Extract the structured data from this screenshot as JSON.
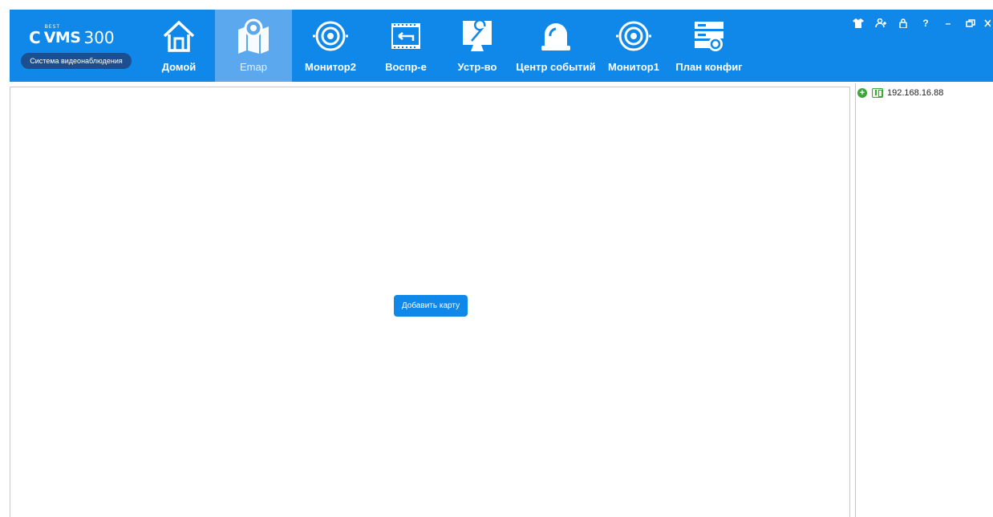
{
  "logo": {
    "brand_small": "BEST",
    "brand": "VMS",
    "number": "300",
    "subtitle": "Система видеонаблюдения"
  },
  "nav": {
    "items": [
      {
        "label": "Домой",
        "icon": "home-icon"
      },
      {
        "label": "Emap",
        "icon": "map-pin-icon",
        "active": true
      },
      {
        "label": "Монитор2",
        "icon": "camera-lens-icon"
      },
      {
        "label": "Воспр-е",
        "icon": "playback-film-icon"
      },
      {
        "label": "Устр-во",
        "icon": "wrench-monitor-icon"
      },
      {
        "label": "Центр событий",
        "icon": "alarm-bell-icon"
      },
      {
        "label": "Монитор1",
        "icon": "camera-lens-icon"
      },
      {
        "label": "План конфиг",
        "icon": "schedule-config-icon"
      }
    ]
  },
  "window_controls": [
    "shirt-icon",
    "user-switch-icon",
    "lock-icon",
    "help-icon",
    "minimize-icon",
    "restore-icon",
    "close-icon"
  ],
  "window_controls_text": {
    "help": "?",
    "minimize": "–"
  },
  "map": {
    "add_map_label": "Добавить карту"
  },
  "devices": [
    {
      "label": "192.168.16.88"
    }
  ],
  "colors": {
    "accent": "#1088e9",
    "active_tab": "#5ba8ee",
    "status_green": "#3da53a"
  }
}
